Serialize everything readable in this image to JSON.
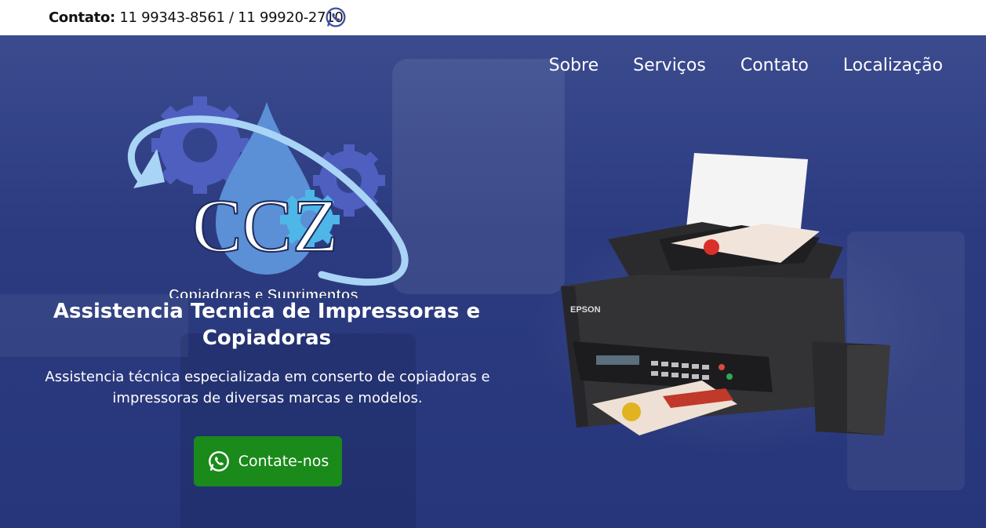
{
  "topbar": {
    "label": "Contato:",
    "phones": "11 99343-8561 / 11 99920-2710",
    "whatsapp_icon": "whatsapp-icon"
  },
  "nav": {
    "items": [
      {
        "label": "Sobre"
      },
      {
        "label": "Serviços"
      },
      {
        "label": "Contato"
      },
      {
        "label": "Localização"
      }
    ]
  },
  "logo": {
    "mark": "CCZ",
    "tagline": "Copiadoras e Suprimentos"
  },
  "hero": {
    "title": "Assistencia Tecnica de Impressoras e Copiadoras",
    "description": "Assistencia técnica especializada em conserto de copiadoras e impressoras de diversas marcas e modelos.",
    "cta_label": "Contate-nos",
    "printer_brand": "EPSON"
  },
  "colors": {
    "hero_bg": "#2c3b80",
    "cta_green": "#1a8a1a",
    "whatsapp_icon": "#3b4fa0"
  }
}
